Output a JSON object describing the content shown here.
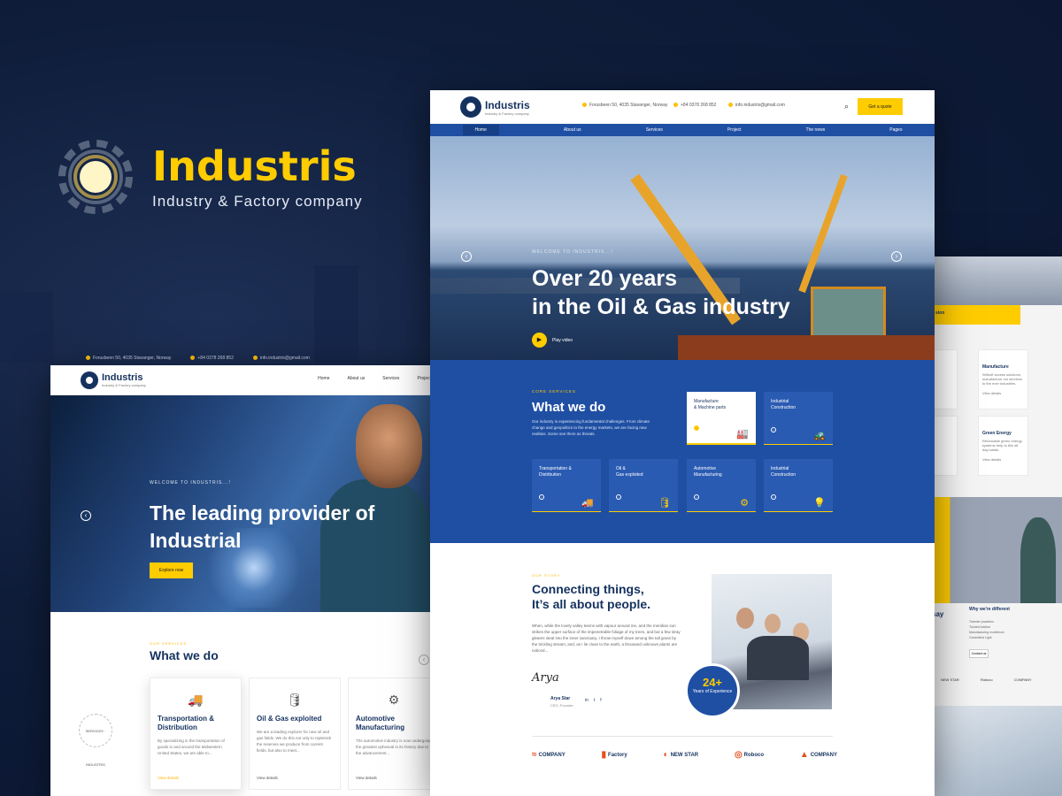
{
  "brand": {
    "title": "Industris",
    "subtitle": "Industry & Factory company"
  },
  "left_mock": {
    "topbar": [
      "Forusbeen 50, 4035 Stavanger, Norway",
      "+84 0378 268 852",
      "info.industris@gmail.com"
    ],
    "logo": {
      "name": "Industris",
      "tag": "Industry & Factory company"
    },
    "nav": [
      "Home",
      "About us",
      "Services",
      "Project"
    ],
    "hero": {
      "kicker": "WELCOME TO INDUSTRIS...!",
      "title": "The leading provider of Industrial",
      "button": "Explore now"
    },
    "services": {
      "kicker": "OUR SERVICES",
      "title": "What we do"
    },
    "cards": [
      {
        "icon": "🚚",
        "title": "Transportation & Distribution",
        "desc": "By specializing in the transportation of goods in and around the Midwestern United States, we are able to...",
        "more": "View details"
      },
      {
        "icon": "🛢",
        "title": "Oil & Gas exploited",
        "desc": "We are a leading explorer for new oil and gas fields. We do this not only to replenish the reserves we produce from current fields, but also to meet...",
        "more": "View details"
      },
      {
        "icon": "⚙",
        "title": "Automotive Manufacturing",
        "desc": "The automotive industry is now undergoing the greatest upheaval in its history due to the advancement...",
        "more": "View details"
      }
    ],
    "badge": "SERVICES · INDUSTRIS"
  },
  "right_mock": {
    "yellow_text": "sion",
    "cards": [
      {
        "title": "Manufacture",
        "desc": "Withoff access solutions, manufacture our services to the ever industries.",
        "more": "View details"
      },
      {
        "title": "Green Energy",
        "desc": "Renewable green energy systems help to this all day lobals.",
        "more": "View details"
      }
    ],
    "why_title": "Why we're different",
    "say": "say",
    "list": [
      "Transfer practices",
      "Trusted Advisor",
      "Manufacturing excellence",
      "Committed Light"
    ],
    "button": "Contact us",
    "logos": [
      "NEW STAR",
      "Roboco",
      "COMPANY"
    ]
  },
  "center_mock": {
    "logo": {
      "name": "Industris",
      "tag": "Industry & Factory company"
    },
    "info": [
      "Forusbeen 50, 4035 Stavanger, Norway",
      "+84 0378 268 852",
      "info.industris@gmail.com"
    ],
    "quote_button": "Get a quote",
    "nav": [
      "Home",
      "About us",
      "Services",
      "Project",
      "The news",
      "Pages"
    ],
    "hero": {
      "kicker": "WELCOME TO INDUSTRIS...!",
      "title_line1": "Over 20 years",
      "title_line2": "in the Oil & Gas industry",
      "play": "Play video"
    },
    "core": {
      "kicker": "CORE SERVICES",
      "title": "What we do",
      "desc": "Our industry is experiencing fundamental challenges. From climate change and geopolitics to the energy markets, we are facing new realities. Some see them as threats."
    },
    "cards": [
      {
        "line1": "Manufacture",
        "line2": "& Machine parts",
        "icon": "🏭"
      },
      {
        "line1": "Industrial",
        "line2": "Construction",
        "icon": "🚜"
      },
      {
        "line1": "Transportation &",
        "line2": "Distribution",
        "icon": "🚚"
      },
      {
        "line1": "Oil &",
        "line2": "Gas exploited",
        "icon": "🛢"
      },
      {
        "line1": "Automotive",
        "line2": "Manufacturing",
        "icon": "⚙"
      },
      {
        "line1": "Industrial",
        "line2": "Construction",
        "icon": "💡"
      }
    ],
    "story": {
      "kicker": "OUR STORY",
      "title_line1": "Connecting things,",
      "title_line2": "It’s all about people.",
      "text": "When, while the lovely valley teems with vapour around me, and the meridian sun strikes the upper surface of the impenetrable foliage of my trees, and but a few stray gleams steal into the inner sanctuary, I throw myself down among the tall grass by the trickling stream; and, as I lie close to the earth, a thousand unknown plants are noticed...",
      "signature": "Arya",
      "name": "Arya Star",
      "role": "CEO, Founder",
      "social": [
        "in",
        "t",
        "f"
      ]
    },
    "experience": {
      "number": "24+",
      "label": "Years of Experience"
    },
    "logos": [
      "COMPANY",
      "Factory",
      "NEW STAR",
      "Roboco",
      "COMPANY"
    ]
  }
}
